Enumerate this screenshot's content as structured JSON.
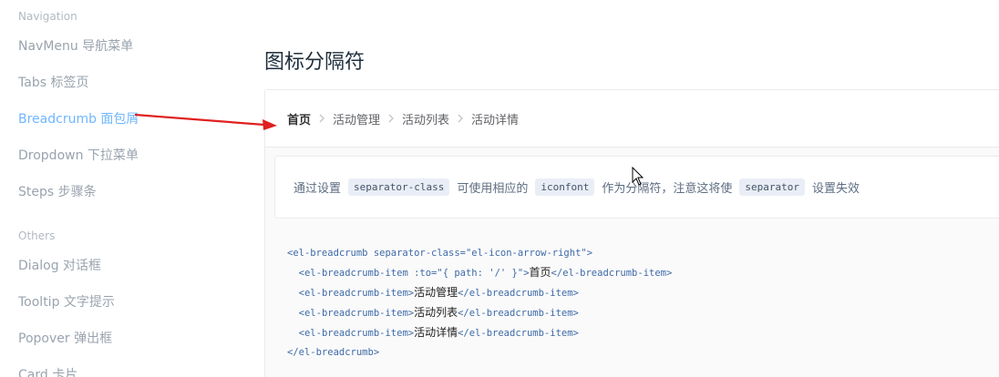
{
  "sidebar": {
    "group_navigation": "Navigation",
    "group_others": "Others",
    "items": [
      {
        "label": "NavMenu 导航菜单"
      },
      {
        "label": "Tabs 标签页"
      },
      {
        "label": "Breadcrumb 面包屑"
      },
      {
        "label": "Dropdown 下拉菜单"
      },
      {
        "label": "Steps 步骤条"
      },
      {
        "label": "Dialog 对话框"
      },
      {
        "label": "Tooltip 文字提示"
      },
      {
        "label": "Popover 弹出框"
      },
      {
        "label": "Card 卡片"
      }
    ]
  },
  "main": {
    "title": "图标分隔符",
    "breadcrumb": [
      "首页",
      "活动管理",
      "活动列表",
      "活动详情"
    ],
    "description": {
      "part1": "通过设置",
      "code1": "separator-class",
      "part2": "可使用相应的",
      "code2": "iconfont",
      "part3": "作为分隔符，注意这将使",
      "code3": "separator",
      "part4": "设置失效"
    },
    "code": {
      "l1": "<el-breadcrumb separator-class=\"el-icon-arrow-right\">",
      "l2_open": "<el-breadcrumb-item :to=\"{ path: '/' }\">",
      "l2_text": "首页",
      "l3_open": "<el-breadcrumb-item>",
      "l3_text": "活动管理",
      "l4_open": "<el-breadcrumb-item>",
      "l4_text": "活动列表",
      "l5_open": "<el-breadcrumb-item>",
      "l5_text": "活动详情",
      "item_close": "</el-breadcrumb-item>",
      "l6": "</el-breadcrumb>"
    }
  },
  "colors": {
    "accent": "#409eff",
    "annotation_arrow": "#e02020"
  }
}
